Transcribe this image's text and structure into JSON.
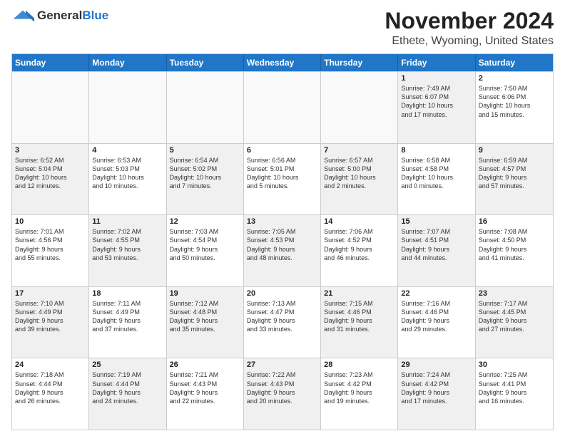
{
  "logo": {
    "general": "General",
    "blue": "Blue"
  },
  "title": "November 2024",
  "location": "Ethete, Wyoming, United States",
  "headers": [
    "Sunday",
    "Monday",
    "Tuesday",
    "Wednesday",
    "Thursday",
    "Friday",
    "Saturday"
  ],
  "rows": [
    [
      {
        "day": "",
        "lines": [],
        "empty": true
      },
      {
        "day": "",
        "lines": [],
        "empty": true
      },
      {
        "day": "",
        "lines": [],
        "empty": true
      },
      {
        "day": "",
        "lines": [],
        "empty": true
      },
      {
        "day": "",
        "lines": [],
        "empty": true
      },
      {
        "day": "1",
        "lines": [
          "Sunrise: 7:49 AM",
          "Sunset: 6:07 PM",
          "Daylight: 10 hours",
          "and 17 minutes."
        ],
        "empty": false
      },
      {
        "day": "2",
        "lines": [
          "Sunrise: 7:50 AM",
          "Sunset: 6:06 PM",
          "Daylight: 10 hours",
          "and 15 minutes."
        ],
        "empty": false
      }
    ],
    [
      {
        "day": "3",
        "lines": [
          "Sunrise: 6:52 AM",
          "Sunset: 5:04 PM",
          "Daylight: 10 hours",
          "and 12 minutes."
        ],
        "empty": false
      },
      {
        "day": "4",
        "lines": [
          "Sunrise: 6:53 AM",
          "Sunset: 5:03 PM",
          "Daylight: 10 hours",
          "and 10 minutes."
        ],
        "empty": false
      },
      {
        "day": "5",
        "lines": [
          "Sunrise: 6:54 AM",
          "Sunset: 5:02 PM",
          "Daylight: 10 hours",
          "and 7 minutes."
        ],
        "empty": false
      },
      {
        "day": "6",
        "lines": [
          "Sunrise: 6:56 AM",
          "Sunset: 5:01 PM",
          "Daylight: 10 hours",
          "and 5 minutes."
        ],
        "empty": false
      },
      {
        "day": "7",
        "lines": [
          "Sunrise: 6:57 AM",
          "Sunset: 5:00 PM",
          "Daylight: 10 hours",
          "and 2 minutes."
        ],
        "empty": false
      },
      {
        "day": "8",
        "lines": [
          "Sunrise: 6:58 AM",
          "Sunset: 4:58 PM",
          "Daylight: 10 hours",
          "and 0 minutes."
        ],
        "empty": false
      },
      {
        "day": "9",
        "lines": [
          "Sunrise: 6:59 AM",
          "Sunset: 4:57 PM",
          "Daylight: 9 hours",
          "and 57 minutes."
        ],
        "empty": false
      }
    ],
    [
      {
        "day": "10",
        "lines": [
          "Sunrise: 7:01 AM",
          "Sunset: 4:56 PM",
          "Daylight: 9 hours",
          "and 55 minutes."
        ],
        "empty": false
      },
      {
        "day": "11",
        "lines": [
          "Sunrise: 7:02 AM",
          "Sunset: 4:55 PM",
          "Daylight: 9 hours",
          "and 53 minutes."
        ],
        "empty": false
      },
      {
        "day": "12",
        "lines": [
          "Sunrise: 7:03 AM",
          "Sunset: 4:54 PM",
          "Daylight: 9 hours",
          "and 50 minutes."
        ],
        "empty": false
      },
      {
        "day": "13",
        "lines": [
          "Sunrise: 7:05 AM",
          "Sunset: 4:53 PM",
          "Daylight: 9 hours",
          "and 48 minutes."
        ],
        "empty": false
      },
      {
        "day": "14",
        "lines": [
          "Sunrise: 7:06 AM",
          "Sunset: 4:52 PM",
          "Daylight: 9 hours",
          "and 46 minutes."
        ],
        "empty": false
      },
      {
        "day": "15",
        "lines": [
          "Sunrise: 7:07 AM",
          "Sunset: 4:51 PM",
          "Daylight: 9 hours",
          "and 44 minutes."
        ],
        "empty": false
      },
      {
        "day": "16",
        "lines": [
          "Sunrise: 7:08 AM",
          "Sunset: 4:50 PM",
          "Daylight: 9 hours",
          "and 41 minutes."
        ],
        "empty": false
      }
    ],
    [
      {
        "day": "17",
        "lines": [
          "Sunrise: 7:10 AM",
          "Sunset: 4:49 PM",
          "Daylight: 9 hours",
          "and 39 minutes."
        ],
        "empty": false
      },
      {
        "day": "18",
        "lines": [
          "Sunrise: 7:11 AM",
          "Sunset: 4:49 PM",
          "Daylight: 9 hours",
          "and 37 minutes."
        ],
        "empty": false
      },
      {
        "day": "19",
        "lines": [
          "Sunrise: 7:12 AM",
          "Sunset: 4:48 PM",
          "Daylight: 9 hours",
          "and 35 minutes."
        ],
        "empty": false
      },
      {
        "day": "20",
        "lines": [
          "Sunrise: 7:13 AM",
          "Sunset: 4:47 PM",
          "Daylight: 9 hours",
          "and 33 minutes."
        ],
        "empty": false
      },
      {
        "day": "21",
        "lines": [
          "Sunrise: 7:15 AM",
          "Sunset: 4:46 PM",
          "Daylight: 9 hours",
          "and 31 minutes."
        ],
        "empty": false
      },
      {
        "day": "22",
        "lines": [
          "Sunrise: 7:16 AM",
          "Sunset: 4:46 PM",
          "Daylight: 9 hours",
          "and 29 minutes."
        ],
        "empty": false
      },
      {
        "day": "23",
        "lines": [
          "Sunrise: 7:17 AM",
          "Sunset: 4:45 PM",
          "Daylight: 9 hours",
          "and 27 minutes."
        ],
        "empty": false
      }
    ],
    [
      {
        "day": "24",
        "lines": [
          "Sunrise: 7:18 AM",
          "Sunset: 4:44 PM",
          "Daylight: 9 hours",
          "and 26 minutes."
        ],
        "empty": false
      },
      {
        "day": "25",
        "lines": [
          "Sunrise: 7:19 AM",
          "Sunset: 4:44 PM",
          "Daylight: 9 hours",
          "and 24 minutes."
        ],
        "empty": false
      },
      {
        "day": "26",
        "lines": [
          "Sunrise: 7:21 AM",
          "Sunset: 4:43 PM",
          "Daylight: 9 hours",
          "and 22 minutes."
        ],
        "empty": false
      },
      {
        "day": "27",
        "lines": [
          "Sunrise: 7:22 AM",
          "Sunset: 4:43 PM",
          "Daylight: 9 hours",
          "and 20 minutes."
        ],
        "empty": false
      },
      {
        "day": "28",
        "lines": [
          "Sunrise: 7:23 AM",
          "Sunset: 4:42 PM",
          "Daylight: 9 hours",
          "and 19 minutes."
        ],
        "empty": false
      },
      {
        "day": "29",
        "lines": [
          "Sunrise: 7:24 AM",
          "Sunset: 4:42 PM",
          "Daylight: 9 hours",
          "and 17 minutes."
        ],
        "empty": false
      },
      {
        "day": "30",
        "lines": [
          "Sunrise: 7:25 AM",
          "Sunset: 4:41 PM",
          "Daylight: 9 hours",
          "and 16 minutes."
        ],
        "empty": false
      }
    ]
  ]
}
